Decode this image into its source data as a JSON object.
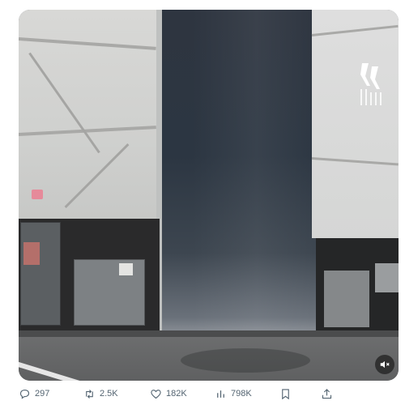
{
  "media": {
    "logo_icon": "logo-watermark-icon",
    "mute_icon": "speaker-muted-icon"
  },
  "actions": {
    "reply": {
      "count": "297",
      "icon": "reply-icon"
    },
    "repost": {
      "count": "2.5K",
      "icon": "repost-icon"
    },
    "like": {
      "count": "182K",
      "icon": "heart-icon"
    },
    "views": {
      "count": "798K",
      "icon": "views-chart-icon"
    },
    "bookmark": {
      "icon": "bookmark-icon"
    },
    "share": {
      "icon": "share-icon"
    }
  },
  "colors": {
    "action_text": "#536471",
    "background": "#ffffff"
  }
}
